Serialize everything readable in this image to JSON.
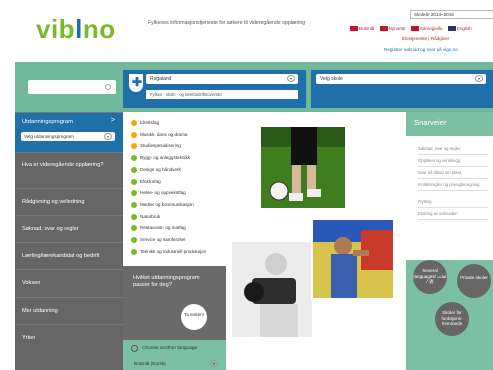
{
  "header": {
    "logo_part1": "vib",
    "logo_part2": "l",
    "logo_part3": "no",
    "tagline": "Fylkenes informasjonstjeneste for søkere til videregående opplæring",
    "year_select": "Skoleår 2014–2015",
    "languages": [
      "Bokmål",
      "Nynorsk",
      "Sámegiella",
      "English"
    ],
    "links": [
      "Elevtjeneste",
      "Rådgiver"
    ],
    "register_line": "Registrer søknad og svar på vigo.no"
  },
  "search": {
    "placeholder": ""
  },
  "county": {
    "selected": "Rogaland",
    "subtitle": "Fylkes - skole - og lærebedriftsoversikt",
    "school_placeholder": "Velg skole"
  },
  "left_menu": {
    "program_title": "Utdanningsprogram",
    "program_chevron": ">",
    "program_select": "Velg utdanningsprogram",
    "items": [
      "Hva er videregående opplæring?",
      "Rådgivning og veiledning",
      "Søknad, svar og regler",
      "Lærling/lærekandidat og bedrift",
      "Voksen",
      "Mer utdanning",
      "Yrker"
    ]
  },
  "programs": [
    {
      "name": "Idrettsfag",
      "color": "#f2a900"
    },
    {
      "name": "Musikk, dans og drama",
      "color": "#f2a900"
    },
    {
      "name": "Studiespesialisering",
      "color": "#f2a900"
    },
    {
      "name": "Bygg- og anleggsteknikk",
      "color": "#7ab929"
    },
    {
      "name": "Design og håndverk",
      "color": "#7ab929"
    },
    {
      "name": "Elektrofag",
      "color": "#7ab929"
    },
    {
      "name": "Helse- og oppvekstfag",
      "color": "#7ab929"
    },
    {
      "name": "Medier og kommunikasjon",
      "color": "#7ab929"
    },
    {
      "name": "Naturbruk",
      "color": "#7ab929"
    },
    {
      "name": "Restaurant- og matfag",
      "color": "#7ab929"
    },
    {
      "name": "Service og samferdsel",
      "color": "#7ab929"
    },
    {
      "name": "Teknikk og industriell produksjon",
      "color": "#7ab929"
    }
  ],
  "quiz": {
    "question": "Hvilket utdanningsprogram passer for deg?",
    "button": "Ta testen!"
  },
  "language_chooser": {
    "label": "Choose another language",
    "selected": "Bokmål (Norsk)"
  },
  "shortcuts": {
    "title": "Snarveier",
    "links": [
      "Søknad, svar og regler",
      "Opptaket og ventelegg",
      "Svar på tilbud om plass",
      "Inntaksregler og poengberegning",
      "Flytting",
      "Endring av søknaden"
    ],
    "circles": [
      "Several languages/ لغات / 语",
      "Private skoler",
      "Skoler for funksjons-hemmede"
    ]
  },
  "colors": {
    "brand_green": "#7ab929",
    "brand_blue": "#1f6fa8",
    "band": "#7bbfa5",
    "menu_grey": "#666666"
  }
}
